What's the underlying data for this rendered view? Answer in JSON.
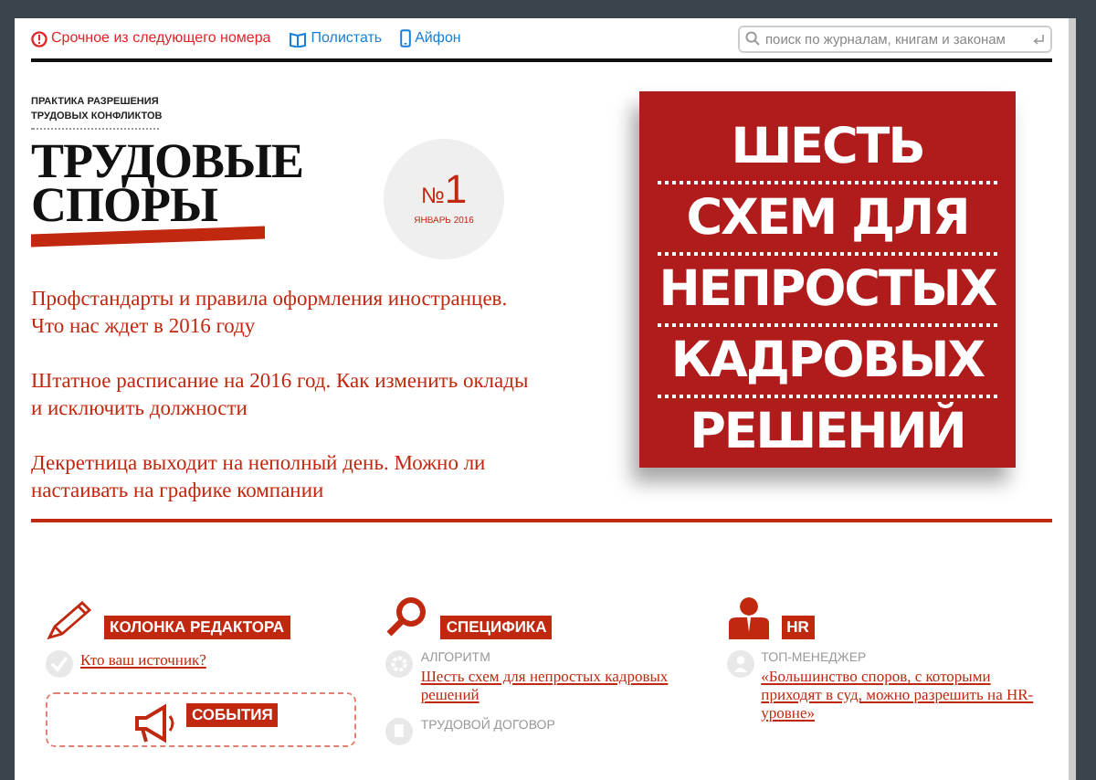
{
  "top_links": [
    {
      "kind": "alert",
      "label": "Срочное из следующего номера"
    },
    {
      "kind": "book",
      "label": "Полистать"
    },
    {
      "kind": "phone",
      "label": "Айфон"
    }
  ],
  "search": {
    "placeholder": "поиск по журналам, книгам и законам"
  },
  "masthead": {
    "tagline_lines": [
      "ПРАКТИКА РАЗРЕШЕНИЯ",
      "ТРУДОВЫХ КОНФЛИКТОВ"
    ],
    "title_lines": [
      "ТРУДОВЫЕ",
      "СПОРЫ"
    ]
  },
  "issue": {
    "number_sign": "№",
    "number": "1",
    "date": "ЯНВАРЬ 2016"
  },
  "headlines": [
    "Профстандарты и правила оформления иностранцев. Что нас ждет в 2016 году",
    "Штатное расписание на 2016 год. Как изменить оклады и исключить должности",
    "Декретница выходит на неполный день. Можно ли настаивать на графике компании"
  ],
  "cover": {
    "lines": [
      "ШЕСТЬ",
      "СХЕМ ДЛЯ",
      "НЕПРОСТЫХ",
      "КАДРОВЫХ",
      "РЕШЕНИЙ"
    ]
  },
  "sections": [
    {
      "kind": "pencil",
      "tag": "КОЛОНКА РЕДАКТОРА",
      "items": [
        {
          "kind": "check",
          "link": "Кто ваш источник?"
        }
      ],
      "box": {
        "kind": "megaphone",
        "tag": "СОБЫТИЯ"
      }
    },
    {
      "kind": "magnifier",
      "tag": "СПЕЦИФИКА",
      "items": [
        {
          "kind": "gear",
          "label": "АЛГОРИТМ",
          "link": "Шесть схем для непростых кадровых решений"
        },
        {
          "kind": "doc",
          "label": "ТРУДОВОЙ ДОГОВОР"
        }
      ]
    },
    {
      "kind": "person",
      "tag": "HR",
      "items": [
        {
          "kind": "person",
          "label": "ТОП-МЕНЕДЖЕР",
          "link": "«Большинство споров, с которыми приходят в суд, можно разрешить на HR-уровне»"
        }
      ]
    }
  ]
}
